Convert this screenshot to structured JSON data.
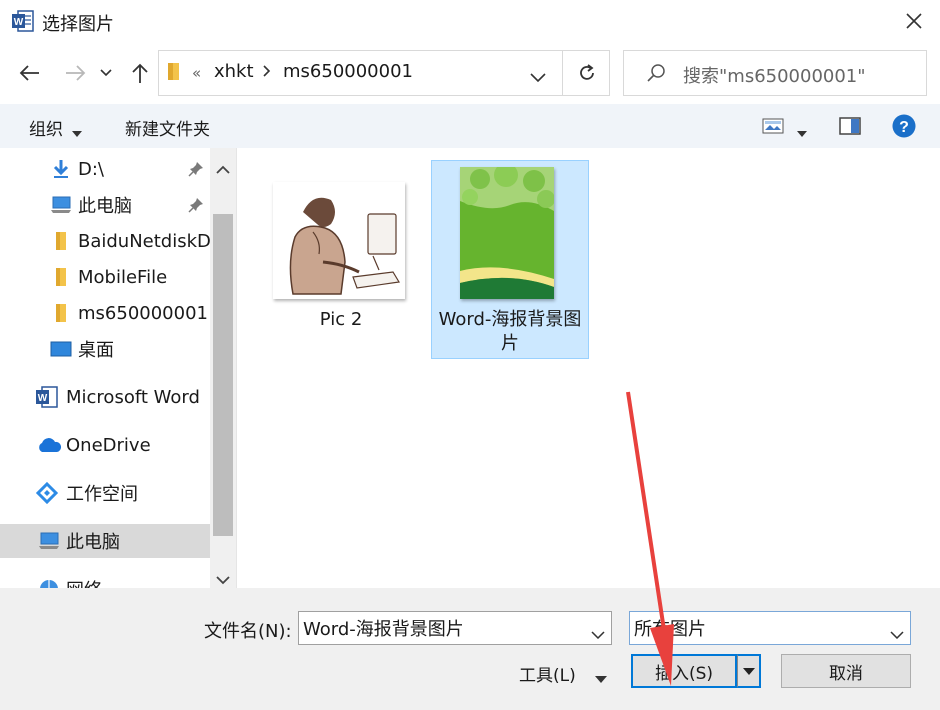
{
  "window": {
    "title": "选择图片"
  },
  "address": {
    "overflow": "«",
    "crumbs": [
      "xhkt",
      "ms650000001"
    ]
  },
  "search": {
    "placeholder": "搜索\"ms650000001\""
  },
  "toolbar": {
    "organize": "组织",
    "new_folder": "新建文件夹"
  },
  "nav": {
    "items": [
      {
        "label": "D:\\",
        "icon": "download-arrow-icon",
        "pinned": true
      },
      {
        "label": "此电脑",
        "icon": "computer-icon",
        "pinned": true
      },
      {
        "label": "BaiduNetdiskD",
        "icon": "folder-icon"
      },
      {
        "label": "MobileFile",
        "icon": "folder-icon"
      },
      {
        "label": "ms650000001",
        "icon": "folder-icon"
      },
      {
        "label": "桌面",
        "icon": "desktop-icon"
      },
      {
        "label": "Microsoft Word",
        "icon": "word-icon"
      },
      {
        "label": "OneDrive",
        "icon": "cloud-icon"
      },
      {
        "label": "工作空间",
        "icon": "workspace-icon"
      },
      {
        "label": "此电脑",
        "icon": "computer-icon",
        "selected": true
      },
      {
        "label": "网络",
        "icon": "network-icon"
      }
    ]
  },
  "files": [
    {
      "name": "Pic 2"
    },
    {
      "name": "Word-海报背景图片",
      "selected": true
    }
  ],
  "footer": {
    "filename_label": "文件名(N):",
    "filename_value": "Word-海报背景图片",
    "filetype_value": "所有图片",
    "tools_label": "工具(L)",
    "insert_label": "插入(S)",
    "cancel_label": "取消"
  },
  "colors": {
    "accent": "#0078d7",
    "selection": "#cce8ff",
    "annotation_arrow": "#e8413d"
  }
}
